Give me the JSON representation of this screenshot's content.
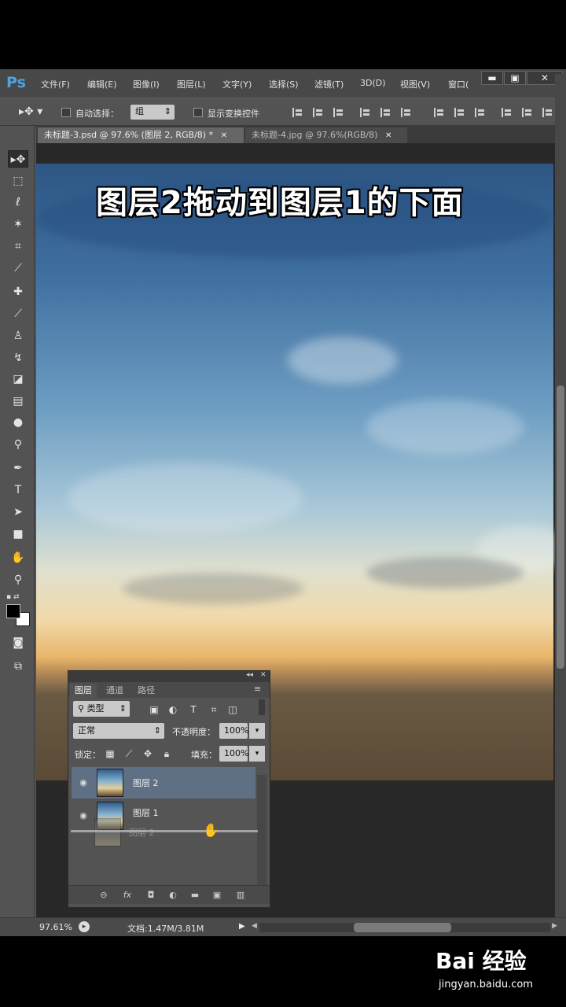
{
  "app": {
    "logo": "Ps"
  },
  "menu": [
    "文件(F)",
    "编辑(E)",
    "图像(I)",
    "图层(L)",
    "文字(Y)",
    "选择(S)",
    "滤镜(T)",
    "3D(D)",
    "视图(V)",
    "窗口("
  ],
  "window_buttons": {
    "minimize": "▬",
    "maximize": "▣",
    "close": "✕"
  },
  "options": {
    "auto_select_label": "自动选择：",
    "auto_select_value": "组",
    "show_transform_label": "显示变换控件"
  },
  "tabs": [
    {
      "label": "未标题-3.psd @ 97.6% (图层 2, RGB/8) *",
      "close": "✕",
      "active": true
    },
    {
      "label": "未标题-4.jpg @ 97.6%(RGB/8)",
      "close": "✕",
      "active": false
    }
  ],
  "tools": [
    "move-tool-icon",
    "marquee-tool-icon",
    "lasso-tool-icon",
    "magic-wand-tool-icon",
    "crop-tool-icon",
    "eyedropper-tool-icon",
    "healing-brush-tool-icon",
    "brush-tool-icon",
    "clone-stamp-tool-icon",
    "history-brush-tool-icon",
    "eraser-tool-icon",
    "gradient-tool-icon",
    "blur-tool-icon",
    "dodge-tool-icon",
    "pen-tool-icon",
    "type-tool-icon",
    "path-selection-tool-icon",
    "rectangle-tool-icon",
    "hand-tool-icon",
    "zoom-tool-icon"
  ],
  "caption": "图层2拖动到图层1的下面",
  "status": {
    "zoom": "97.61%",
    "doc_info": "文档:1.47M/3.81M"
  },
  "layers_panel": {
    "tabs": [
      "图层",
      "通道",
      "路径"
    ],
    "filter_kind": "类型",
    "blend_mode": "正常",
    "opacity_label": "不透明度：",
    "opacity_value": "100%",
    "lock_label": "锁定：",
    "fill_label": "填充：",
    "fill_value": "100%",
    "layers": [
      {
        "name": "图层 2",
        "selected": true
      },
      {
        "name": "图层 1",
        "selected": false
      }
    ],
    "drag_ghost_name": "图层 2",
    "footer_icons": [
      "link-icon",
      "fx-icon",
      "mask-icon",
      "adjustment-icon",
      "folder-icon",
      "new-layer-icon",
      "trash-icon"
    ],
    "footer_glyphs": {
      "link": "⊖",
      "fx": "fx",
      "mask": "◘",
      "adjustment": "◐",
      "folder": "▬",
      "new_layer": "▣",
      "trash": "▥"
    }
  },
  "watermark": {
    "main": "Bai 经验",
    "url": "jingyan.baidu.com"
  }
}
